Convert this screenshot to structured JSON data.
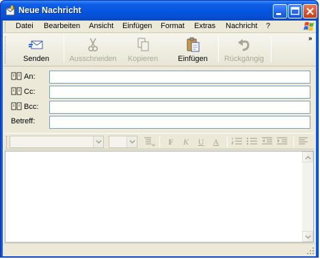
{
  "window": {
    "title": "Neue Nachricht",
    "controls": {
      "minimize": "minimize-icon",
      "maximize": "maximize-icon",
      "close": "close-icon"
    }
  },
  "menubar": {
    "items": [
      "Datei",
      "Bearbeiten",
      "Ansicht",
      "Einfügen",
      "Format",
      "Extras",
      "Nachricht",
      "?"
    ]
  },
  "toolbar": {
    "overflow": "»",
    "buttons": [
      {
        "label": "Senden",
        "icon": "send-icon",
        "enabled": true
      },
      {
        "label": "Ausschneiden",
        "icon": "scissors-icon",
        "enabled": false
      },
      {
        "label": "Kopieren",
        "icon": "copy-icon",
        "enabled": false
      },
      {
        "label": "Einfügen",
        "icon": "paste-icon",
        "enabled": true
      },
      {
        "label": "Rückgängig",
        "icon": "undo-icon",
        "enabled": false
      }
    ]
  },
  "headers": {
    "to_label": "An:",
    "cc_label": "Cc:",
    "bcc_label": "Bcc:",
    "subject_label": "Betreff:",
    "to_value": "",
    "cc_value": "",
    "bcc_value": "",
    "subject_value": ""
  },
  "format_toolbar": {
    "font_value": "",
    "size_value": "",
    "bold": "F",
    "italic": "K",
    "underline": "U",
    "font_color": "A"
  },
  "colors": {
    "title_bar": "#0656e0",
    "close_button": "#d8522c",
    "face": "#ece9d8"
  }
}
